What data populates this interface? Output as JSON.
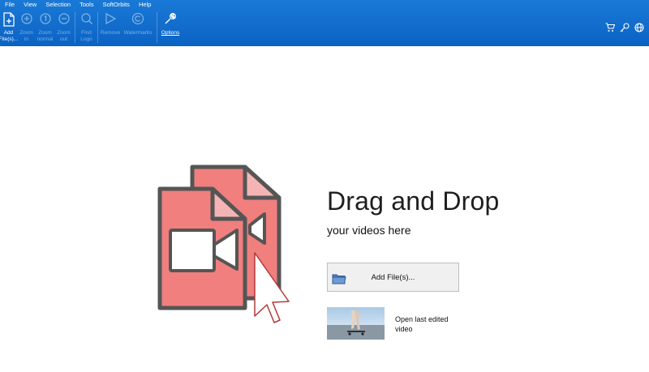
{
  "menu": [
    "File",
    "View",
    "Selection",
    "Tools",
    "SoftOrbits",
    "Help"
  ],
  "toolbar": {
    "add_files": "Add\nFile(s)...",
    "zoom_in": "Zoom\nin",
    "zoom_normal": "Zoom\nnormal",
    "zoom_out": "Zoom\nout",
    "find_logo": "Find\nLogo",
    "remove": "Remove",
    "watermarks": "Watermarks",
    "options": "Options"
  },
  "main": {
    "title": "Drag and Drop",
    "subtitle": "your videos here",
    "add_button": "Add File(s)...",
    "open_last": "Open last edited video"
  },
  "colors": {
    "ribbon": "#0b63c4",
    "file_fill": "#f07f7e",
    "file_stroke": "#555555",
    "fold": "#f4b4b4"
  }
}
